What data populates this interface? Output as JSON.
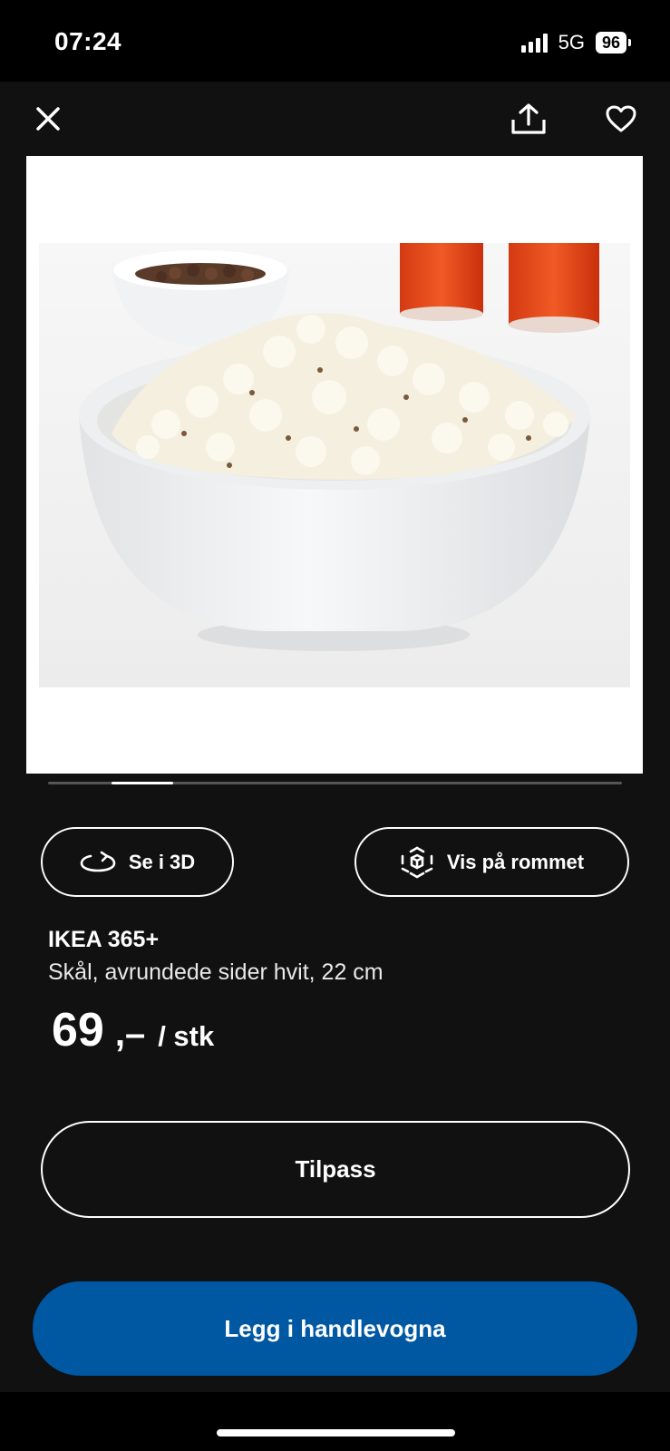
{
  "status": {
    "time": "07:24",
    "network": "5G",
    "battery": "96"
  },
  "product": {
    "brand": "IKEA 365+",
    "description": "Skål, avrundede sider hvit, 22 cm",
    "price_integer": "69",
    "price_decimal": ",–",
    "price_unit": "/ stk"
  },
  "actions": {
    "view_3d": "Se i 3D",
    "view_room": "Vis på rommet",
    "customize": "Tilpass",
    "add_to_cart": "Legg i handlevogna"
  },
  "carousel": {
    "active_index": 1
  },
  "colors": {
    "background": "#111111",
    "cart_button": "#0058a3"
  },
  "icons": [
    "close-icon",
    "share-icon",
    "heart-icon",
    "rotate-3d-icon",
    "ar-cube-icon"
  ]
}
